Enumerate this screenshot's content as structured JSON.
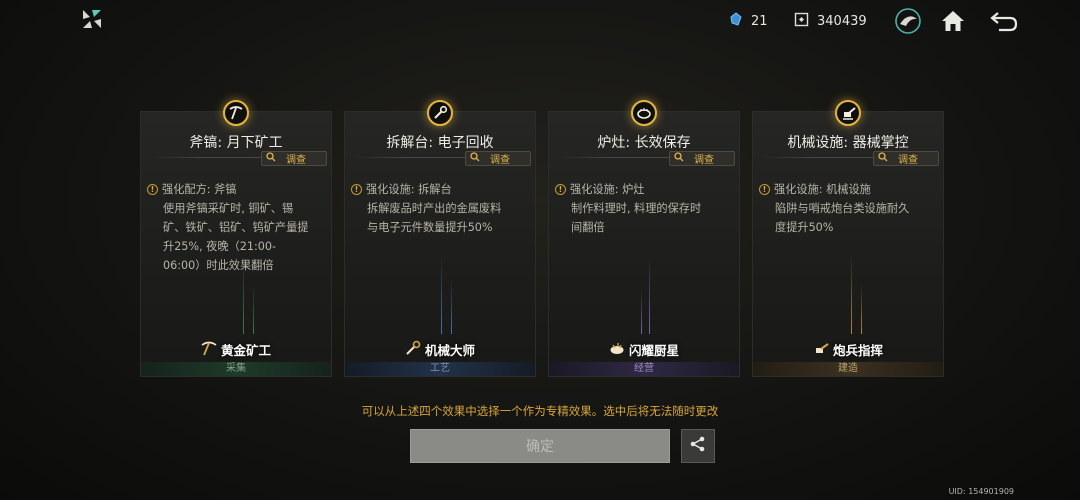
{
  "topbar": {
    "logo_icon": "menu-star-icon",
    "crystal_count": "21",
    "currency_count": "340439"
  },
  "cards": [
    {
      "icon": "pickaxe-icon",
      "title": "斧镐: 月下矿工",
      "inspect_label": "调查",
      "effect_head": "强化配方: 斧镐",
      "effect_lines": [
        "使用斧镐采矿时, 铜矿、锡",
        "矿、铁矿、铝矿、钨矿产量提",
        "升25%, 夜晚（21:00-",
        "06:00）时此效果翻倍"
      ],
      "badge_label": "黄金矿工",
      "category": "采集",
      "accent": "#3f7a52"
    },
    {
      "icon": "wrench-icon",
      "title": "拆解台: 电子回收",
      "inspect_label": "调查",
      "effect_head": "强化设施: 拆解台",
      "effect_lines": [
        "拆解废品时产出的金属废料",
        "与电子元件数量提升50%"
      ],
      "badge_label": "机械大师",
      "category": "工艺",
      "accent": "#4a6fa8"
    },
    {
      "icon": "cooking-pot-icon",
      "title": "炉灶: 长效保存",
      "inspect_label": "调查",
      "effect_head": "强化设施: 炉灶",
      "effect_lines": [
        "制作料理时, 料理的保存时",
        "间翻倍"
      ],
      "badge_label": "闪耀厨星",
      "category": "经营",
      "accent": "#7a5fb0"
    },
    {
      "icon": "turret-icon",
      "title": "机械设施: 器械掌控",
      "inspect_label": "调查",
      "effect_head": "强化设施: 机械设施",
      "effect_lines": [
        "陷阱与哨戒炮台类设施耐久",
        "度提升50%"
      ],
      "badge_label": "炮兵指挥",
      "category": "建造",
      "accent": "#a8874a"
    }
  ],
  "hint": "可以从上述四个效果中选择一个作为专精效果。选中后将无法随时更改",
  "confirm_label": "确定",
  "uid": "UID: 154901909"
}
